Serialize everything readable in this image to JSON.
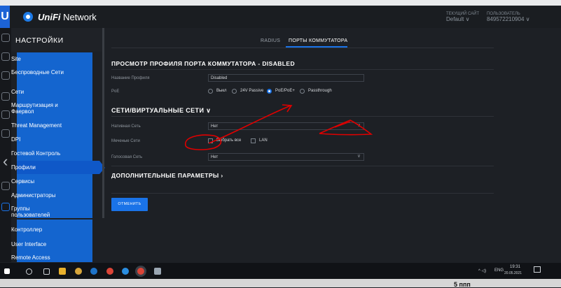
{
  "app": {
    "brand": "UniFi Network",
    "brand_italic": "UniFi",
    "brand_rest": " Network"
  },
  "header": {
    "site_caption": "ТЕКУЩИЙ САЙТ",
    "site_value": "Default",
    "user_caption": "ПОЛЬЗОВАТЕЛЬ",
    "user_value": "849572210904"
  },
  "sidebar": {
    "title": "НАСТРОЙКИ",
    "items": [
      {
        "label": "Site"
      },
      {
        "label": "Беспроводные Сети"
      },
      {
        "label": "Сети"
      },
      {
        "label": "Маршрутизация и Фаервол"
      },
      {
        "label": "Threat Management"
      },
      {
        "label": "DPI"
      },
      {
        "label": "Гостевой Контроль"
      },
      {
        "label": "Профили"
      },
      {
        "label": "Сервисы"
      },
      {
        "label": "Администраторы"
      },
      {
        "label": "Группы пользователей"
      },
      {
        "label": "Контроллер"
      },
      {
        "label": "User Interface"
      },
      {
        "label": "Remote Access"
      }
    ],
    "active_item": "Профили"
  },
  "tabs": [
    {
      "label": "RADIUS"
    },
    {
      "label": "ПОРТЫ КОММУТАТОРА"
    }
  ],
  "profile": {
    "title": "ПРОСМОТР ПРОФИЛЯ ПОРТА КОММУТАТОРА - DISABLED",
    "name_label": "Название Профиля",
    "name_value": "Disabled",
    "poe_label": "PoE",
    "poe_options": [
      "Выкл",
      "24V Passive",
      "PoE/PoE+",
      "Passthrough"
    ],
    "poe_selected": "PoE/PoE+"
  },
  "networks": {
    "title": "СЕТИ/ВИРТУАЛЬНЫЕ СЕТИ",
    "native_label": "Нативная Сеть",
    "native_value": "Нет",
    "tagged_label": "Меченые Сети",
    "tagged_options": [
      "Выбрать все",
      "LAN"
    ],
    "voice_label": "Голосовая Сеть",
    "voice_value": "Нет"
  },
  "advanced": {
    "title": "ДОПОЛНИТЕЛЬНЫЕ ПАРАМЕТРЫ"
  },
  "actions": {
    "cancel_label": "ОТМЕНИТЬ"
  },
  "taskbar": {
    "lang": "ENG",
    "time": "19:31",
    "date": "20.05.2021"
  },
  "bottom": {
    "text": "5 ппп"
  },
  "colors": {
    "accent": "#1a73e8",
    "nav_bg": "#1465cf",
    "annotation": "#e00000"
  }
}
